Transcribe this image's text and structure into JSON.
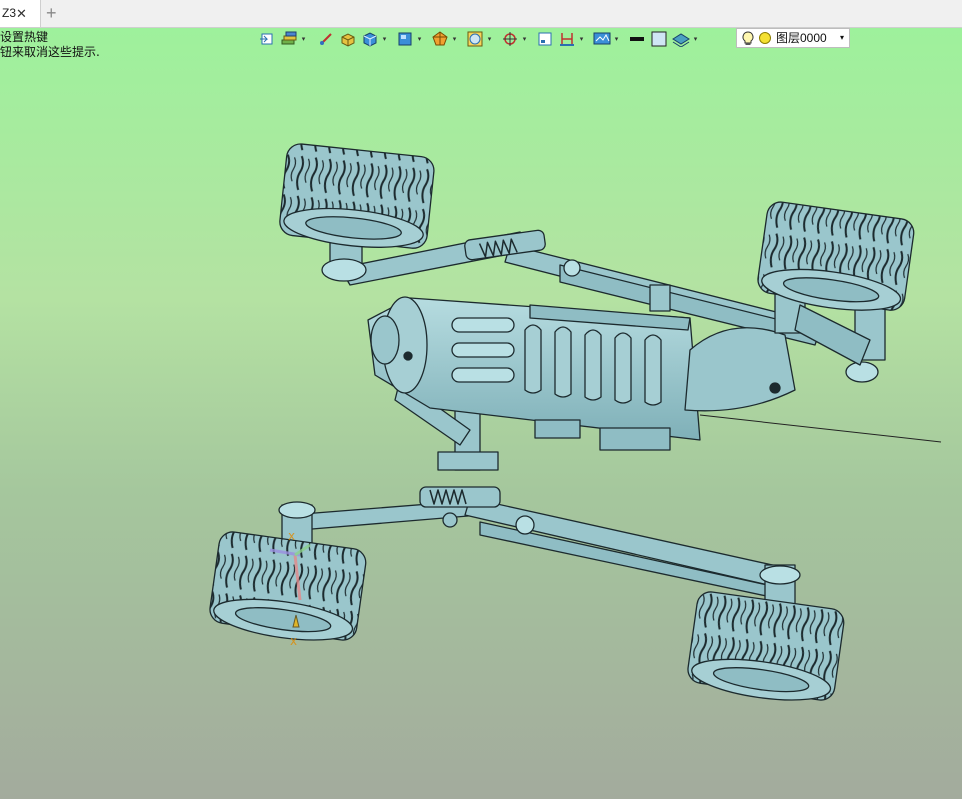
{
  "tab": {
    "label": "Z3",
    "close_glyph": "✕",
    "add_glyph": "+"
  },
  "hint": {
    "line1": "设置热键",
    "line2": "钮来取消这些提示."
  },
  "toolbar": {
    "icons": [
      "view-icon",
      "layers-icon",
      "sketch-icon",
      "box-icon",
      "cube-icon",
      "display-icon",
      "shade-icon",
      "render-icon",
      "snap-icon",
      "frame-icon",
      "dimension-icon",
      "screen-icon",
      "color-icon",
      "fill-icon",
      "stack-icon"
    ]
  },
  "layer": {
    "name": "图层0000",
    "bulb_icon": "lightbulb-icon",
    "status_icon": "yellow-dot-icon",
    "arrow": "▾"
  },
  "colors": {
    "model": "#9ac6cc",
    "edge": "#1c2a2e",
    "bg_top": "#9ef19c",
    "bg_bottom": "#a3ab9d"
  }
}
